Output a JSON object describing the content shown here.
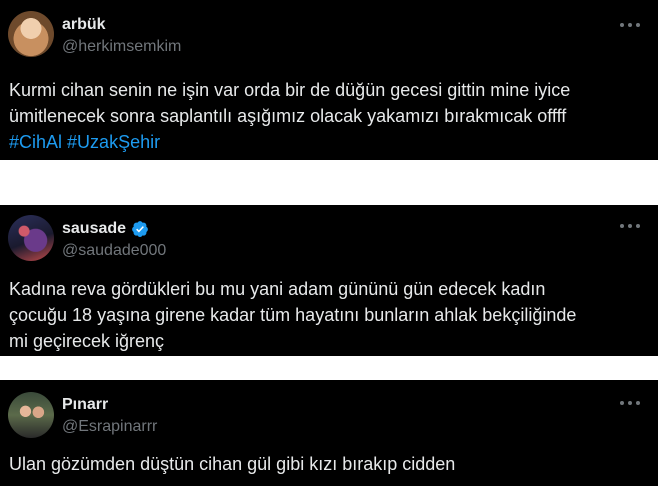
{
  "tweets": [
    {
      "name": "arbük",
      "handle": "@herkimsemkim",
      "verified": false,
      "avatar_icon": "profile-photo",
      "lines": [
        "Kurmi cihan senin ne işin var orda bir de düğün gecesi gittin mine iyice",
        "ümitlenecek sonra saplantılı aşığımız olacak yakamızı bırakmıcak offff"
      ],
      "hashtags": [
        "#CihAl",
        "#UzakŞehir"
      ]
    },
    {
      "name": "sausade",
      "handle": "@saudade000",
      "verified": true,
      "avatar_icon": "profile-photo",
      "lines": [
        "Kadına reva gördükleri bu mu yani adam gününü gün edecek kadın",
        "çocuğu 18 yaşına girene kadar tüm hayatını bunların ahlak bekçiliğinde",
        "mi geçirecek iğrenç"
      ]
    },
    {
      "name": "Pınarr",
      "handle": "@Esrapinarrr",
      "verified": false,
      "avatar_icon": "profile-photo",
      "lines": [
        "Ulan gözümden düştün cihan gül gibi kızı bırakıp cidden"
      ]
    }
  ],
  "colors": {
    "background": "#000000",
    "text": "#e7e9ea",
    "muted": "#71767b",
    "hashtag": "#1d9bf0",
    "verified": "#1d9bf0"
  }
}
